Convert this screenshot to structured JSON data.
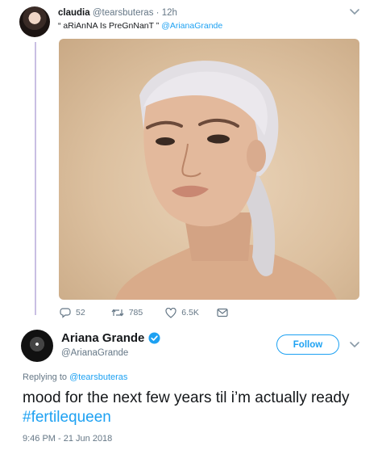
{
  "quoted_tweet": {
    "name": "claudia",
    "handle": "@tearsbuteras",
    "separator": "·",
    "time": "12h",
    "text_prefix": "“ aRiAnNA Is PreGnNanT ” ",
    "mention": "@ArianaGrande",
    "photo_icon": "portrait-photo",
    "actions": {
      "replies": "52",
      "retweets": "785",
      "likes": "6.5K"
    }
  },
  "main_tweet": {
    "name": "Ariana Grande",
    "verified_icon": "verified-badge-icon",
    "handle": "@ArianaGrande",
    "follow_label": "Follow",
    "replying_prefix": "Replying to ",
    "replying_handle": "@tearsbuteras",
    "text": "mood for the next few years til i’m actually ready ",
    "hashtag": "#fertilequeen",
    "timestamp": "9:46 PM - 21 Jun 2018"
  },
  "colors": {
    "accent": "#1da1f2",
    "thread_line": "#c9bfe3",
    "muted": "#657786"
  }
}
